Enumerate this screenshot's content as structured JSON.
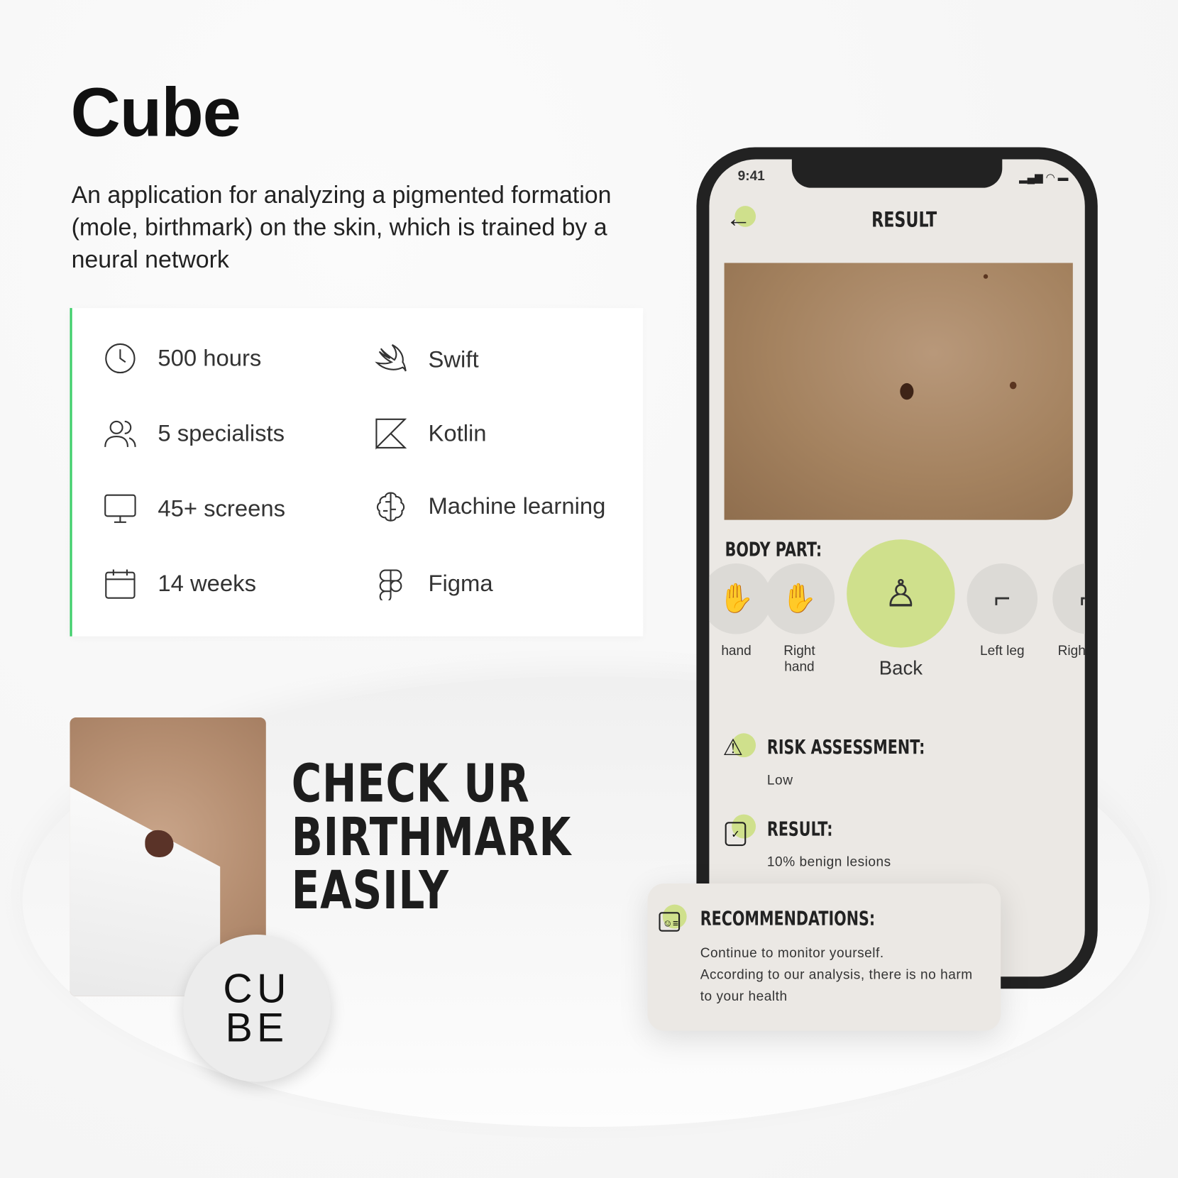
{
  "title": "Cube",
  "description": "An application for analyzing a pigmented formation (mole, birthmark) on the skin, which is trained by a neural network",
  "features": [
    {
      "icon": "clock-icon",
      "label": "500 hours"
    },
    {
      "icon": "swift-icon",
      "label": "Swift"
    },
    {
      "icon": "users-icon",
      "label": "5 specialists"
    },
    {
      "icon": "kotlin-icon",
      "label": "Kotlin"
    },
    {
      "icon": "monitor-icon",
      "label": "45+ screens"
    },
    {
      "icon": "brain-icon",
      "label": "Machine learning"
    },
    {
      "icon": "calendar-icon",
      "label": "14 weeks"
    },
    {
      "icon": "figma-icon",
      "label": "Figma"
    }
  ],
  "slogan": [
    "CHECK UR",
    "BIRTHMARK",
    "EASILY"
  ],
  "sticker_logo": "CUBE",
  "colors": {
    "accent": "#cfe08c",
    "card_border": "#3dcf6a",
    "screen_bg": "#ebe8e4"
  },
  "phone": {
    "status_time": "9:41",
    "screen_title": "RESULT",
    "body_part_label": "BODY PART:",
    "body_parts": [
      {
        "label": "hand",
        "icon": "hand-icon"
      },
      {
        "label": "Right hand",
        "icon": "hand-icon"
      },
      {
        "label": "Back",
        "icon": "back-icon",
        "selected": true
      },
      {
        "label": "Left leg",
        "icon": "foot-icon"
      },
      {
        "label": "Righ",
        "icon": "foot-icon"
      }
    ],
    "risk_label": "RISK ASSESSMENT:",
    "risk_value": "Low",
    "result_label": "RESULT:",
    "result_value": "10% benign lesions"
  },
  "recommendations": {
    "label": "RECOMMENDATIONS:",
    "lines": [
      "Continue to monitor yourself.",
      "According to our analysis, there is no harm",
      "to your health"
    ]
  }
}
